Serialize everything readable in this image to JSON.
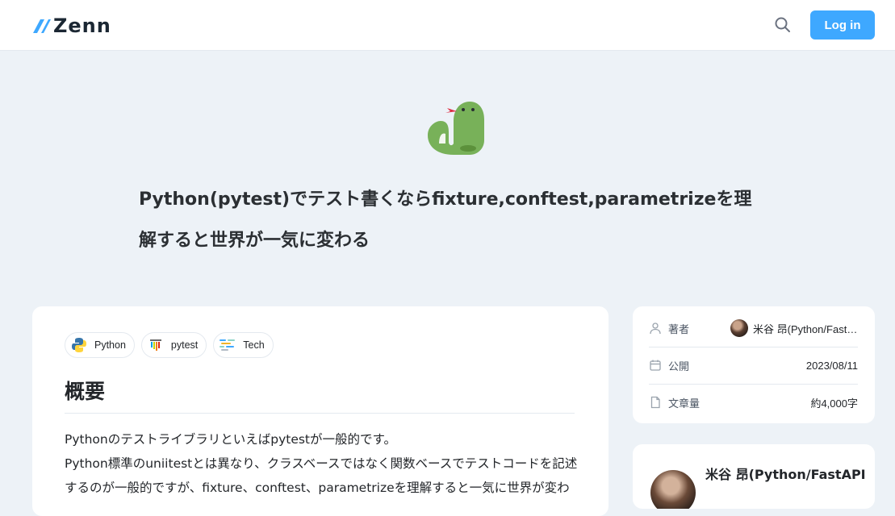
{
  "header": {
    "logo_text": "Zenn",
    "login_label": "Log in",
    "brand_color": "#3ea8ff"
  },
  "article": {
    "emoji": "snake-emoji",
    "title": "Python(pytest)でテスト書くならfixture,conftest,parametrizeを理解すると世界が一気に変わる",
    "topics": [
      {
        "label": "Python",
        "icon": "python-icon"
      },
      {
        "label": "pytest",
        "icon": "pytest-icon"
      },
      {
        "label": "Tech",
        "icon": "tech-icon"
      }
    ],
    "section_heading": "概要",
    "paragraphs": [
      "Pythonのテストライブラリといえばpytestが一般的です。",
      "Python標準のuniitestとは異なり、クラスベースではなく関数ベースでテストコードを記述するのが一般的ですが、fixture、conftest、parametrizeを理解すると一気に世界が変わります。"
    ]
  },
  "sidebar": {
    "info": {
      "author_label": "著者",
      "author_value": "米谷 昂(Python/FastAPI)",
      "published_label": "公開",
      "published_value": "2023/08/11",
      "length_label": "文章量",
      "length_value": "約4,000字"
    },
    "author_card": {
      "name": "米谷 昂(Python/FastAPI"
    }
  }
}
